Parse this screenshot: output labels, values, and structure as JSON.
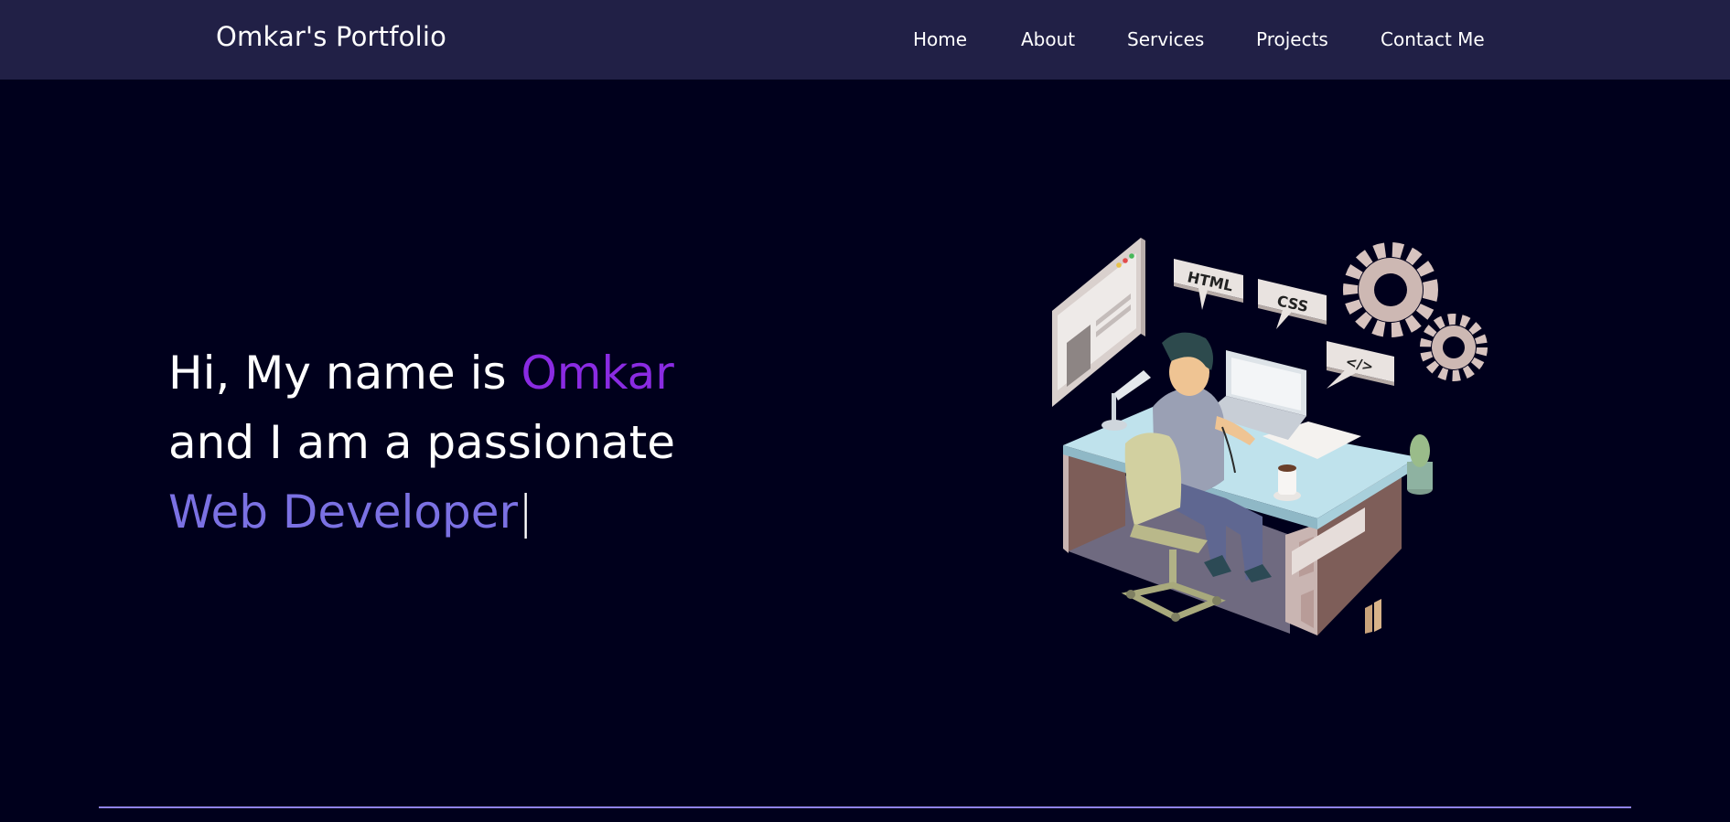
{
  "header": {
    "brand": "Omkar's Portfolio",
    "nav": [
      {
        "label": "Home"
      },
      {
        "label": "About"
      },
      {
        "label": "Services"
      },
      {
        "label": "Projects"
      },
      {
        "label": "Contact Me"
      }
    ]
  },
  "hero": {
    "line1_prefix": "Hi, My name is ",
    "name": "Omkar",
    "line2": "and I am a passionate",
    "role": "Web Developer",
    "cursor": "|",
    "illustration": {
      "icon": "developer-at-desk-illustration",
      "bubbles": {
        "html": "HTML",
        "css": "CSS",
        "code": "</>"
      }
    }
  },
  "colors": {
    "background": "#00001c",
    "navbar": "#212046",
    "name_accent": "#8a2be2",
    "role_accent": "#7b71e3",
    "divider": "#8f82e6"
  }
}
